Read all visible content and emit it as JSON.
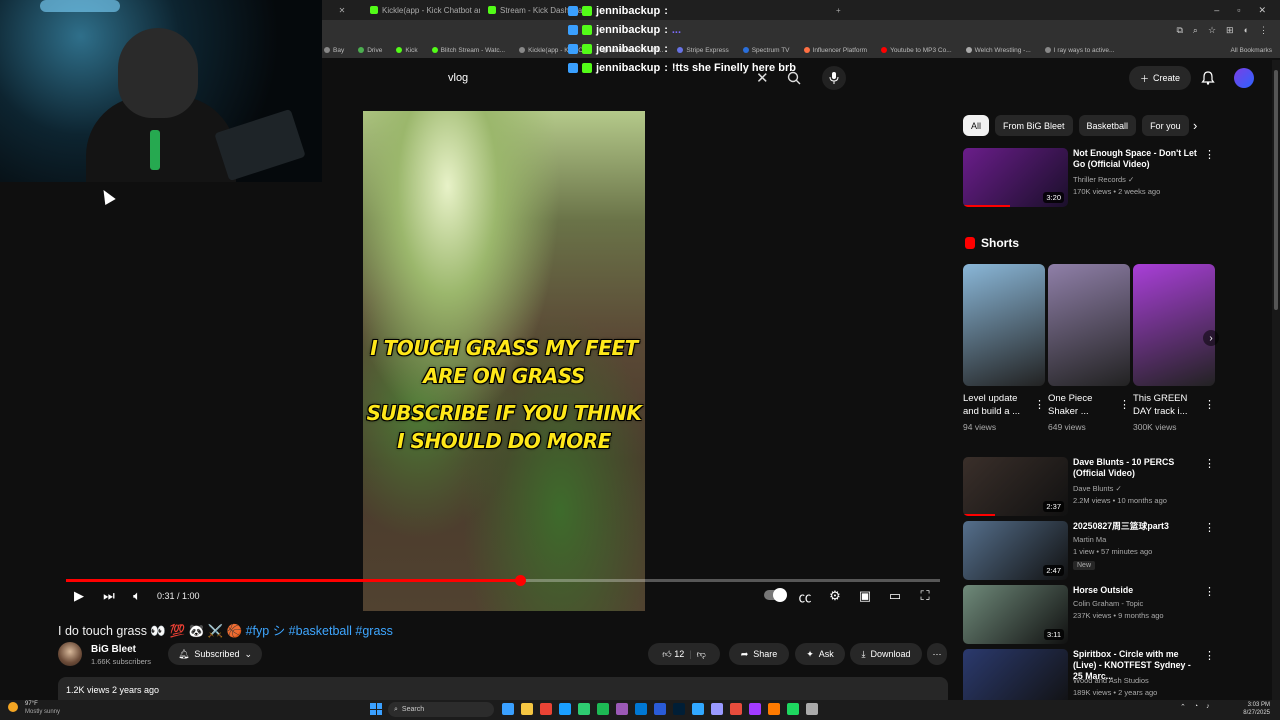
{
  "browser": {
    "tabs": [
      {
        "label": "Kickle(app - Kick Chatbot and",
        "color": "#53fc18",
        "active": false
      },
      {
        "label": "Stream - Kick Dashboard",
        "color": "#53fc18",
        "active": false
      }
    ],
    "bookmarks": [
      {
        "label": "Bay",
        "color": "#888"
      },
      {
        "label": "Drive",
        "color": "#4caf50"
      },
      {
        "label": "Kick",
        "color": "#53fc18"
      },
      {
        "label": "Blitch Stream - Watc...",
        "color": "#53fc18"
      },
      {
        "label": "Kickle(app - Kick C...",
        "color": "#888"
      },
      {
        "label": "and lmmmts - M...",
        "color": "#888"
      },
      {
        "label": "Stripe Express",
        "color": "#6772e5"
      },
      {
        "label": "Spectrum TV",
        "color": "#2a6fdb"
      },
      {
        "label": "Influencer Platform",
        "color": "#ff7043"
      },
      {
        "label": "Youtube to MP3 Co...",
        "color": "#f00"
      },
      {
        "label": "Welch Wrestling -...",
        "color": "#aaa"
      },
      {
        "label": "I ray ways to active...",
        "color": "#888"
      }
    ],
    "all_bookmarks": "All Bookmarks"
  },
  "chat": [
    {
      "user": "jennibackup",
      "sep": ":",
      "msg": "",
      "dim": false
    },
    {
      "user": "jennibackup",
      "sep": ":",
      "msg": "...",
      "dim": true
    },
    {
      "user": "jennibackup",
      "sep": ":",
      "msg": "",
      "dim": false
    },
    {
      "user": "jennibackup",
      "sep": ":",
      "msg": "!tts she Finelly here brb",
      "dim": false
    }
  ],
  "header": {
    "search_value": "vlog",
    "create_label": "Create"
  },
  "video": {
    "overlay_line1": "I TOUCH GRASS MY FEET ARE ON GRASS",
    "overlay_line2": "SUBSCRIBE IF YOU THINK I SHOULD DO MORE",
    "time": "0:31 / 1:00",
    "progress": 0.52,
    "title_text": "I do touch grass 👀 💯 🐼 ⚔️ 🏀 ",
    "title_tags": "#fyp シ #basketball #grass",
    "channel_name": "BiG Bleet",
    "channel_subs": "1.66K subscribers",
    "subscribed_label": "Subscribed",
    "like_count": "12",
    "share_label": "Share",
    "ask_label": "Ask",
    "download_label": "Download",
    "views_line": "1.2K views  2 years ago"
  },
  "chips": [
    "All",
    "From BiG Bleet",
    "Basketball",
    "For you"
  ],
  "recommendations_top": {
    "title": "Not Enough Space - Don't Let Go (Official Video)",
    "channel": "Thriller Records ✓",
    "meta": "170K views • 2 weeks ago",
    "duration": "3:20",
    "watched": 0.45,
    "thumb": "#6a1d8a"
  },
  "shorts": {
    "heading": "Shorts",
    "items": [
      {
        "title": "Level update and build a ...",
        "views": "94 views",
        "thumb": "#8ab7d8"
      },
      {
        "title": "One Piece Shaker ...",
        "views": "649 views",
        "thumb": "#8f7fa8"
      },
      {
        "title": "This GREEN DAY track i...",
        "views": "300K views",
        "thumb": "#a93fd8"
      }
    ]
  },
  "recommendations": [
    {
      "title": "Dave Blunts - 10 PERCS (Official Video)",
      "channel": "Dave Blunts ✓",
      "meta": "2.2M views • 10 months ago",
      "duration": "2:37",
      "watched": 0.3,
      "thumb": "#3a2f2a",
      "new": ""
    },
    {
      "title": "20250827周三篮球part3",
      "channel": "Martin Ma",
      "meta": "1 view • 57 minutes ago",
      "duration": "2:47",
      "watched": 0,
      "thumb": "#556f8c",
      "new": "New"
    },
    {
      "title": "Horse Outside",
      "channel": "Colin Graham - Topic",
      "meta": "237K views • 9 months ago",
      "duration": "3:11",
      "watched": 0,
      "thumb": "#6f8a7a",
      "new": ""
    },
    {
      "title": "Spiritbox - Circle with me (Live) - KNOTFEST Sydney - 25 Marc...",
      "channel": "Wood and Ash Studios",
      "meta": "189K views • 2 years ago",
      "duration": "",
      "watched": 0,
      "thumb": "#2b3a6e",
      "new": ""
    }
  ],
  "taskbar": {
    "temp": "97°F",
    "weather": "Mostly sunny",
    "search": "Search",
    "time": "3:03 PM",
    "date": "8/27/2025",
    "apps": [
      "#3aa0ff",
      "#f4c542",
      "#ea4335",
      "#1a9fff",
      "#2ecc71",
      "#1db954",
      "#9b59b6",
      "#0078d4",
      "#2a5bd7",
      "#001e36",
      "#31a8ff",
      "#9999ff",
      "#e74c3c",
      "#a23bff",
      "#ff7b00",
      "#1ed760",
      "#aaa"
    ]
  }
}
